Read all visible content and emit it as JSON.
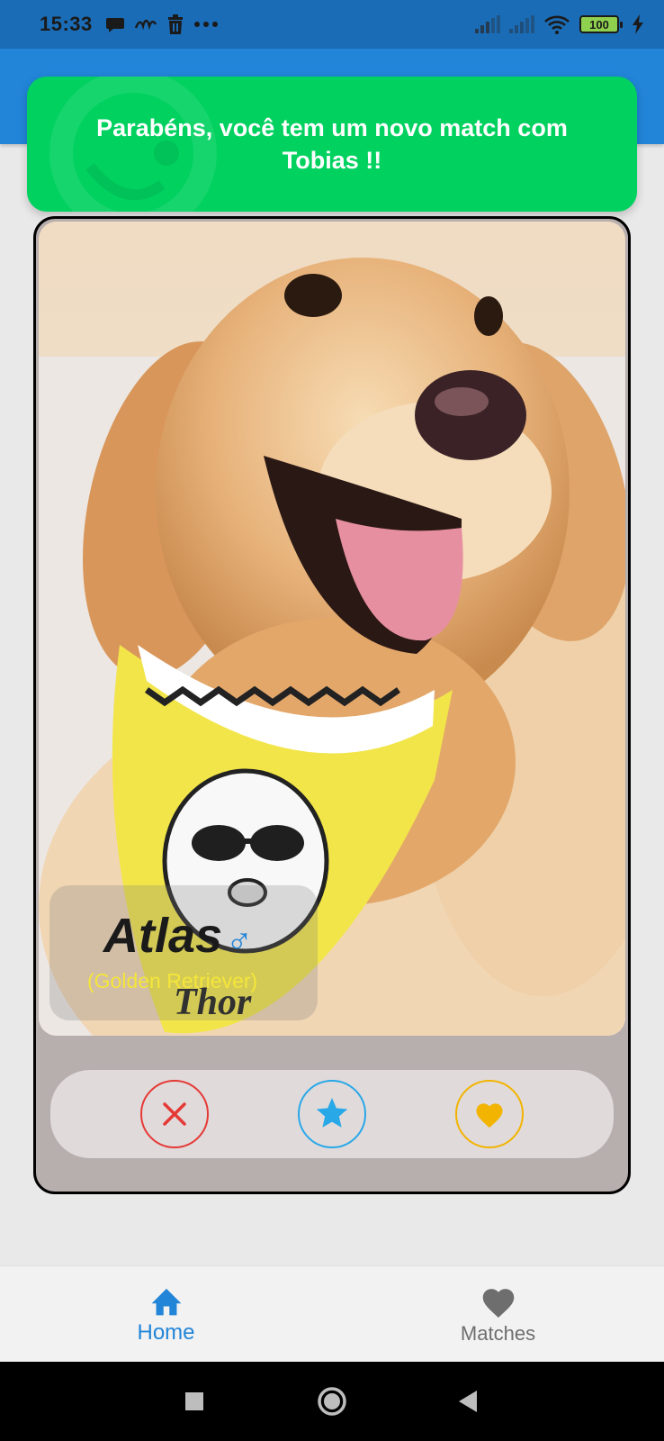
{
  "status_bar": {
    "time": "15:33",
    "battery": "100",
    "icons": [
      "chat-bubble-icon",
      "app-logo-icon",
      "trash-icon",
      "more-dots-icon",
      "signal-icon",
      "signal-icon",
      "wifi-icon",
      "battery-icon",
      "charging-icon"
    ]
  },
  "toast": {
    "message": "Parabéns, você tem um novo match com Tobias !!",
    "color": "#00d15f"
  },
  "card": {
    "pet_name": "Atlas",
    "sex_symbol": "♂",
    "breed": "(Golden Retriever)",
    "photo_text": "Thor",
    "actions": {
      "nope_icon": "close-icon",
      "super_icon": "star-icon",
      "like_icon": "heart-icon"
    }
  },
  "bottom_nav": {
    "items": [
      {
        "label": "Home",
        "icon": "home-icon",
        "active": true
      },
      {
        "label": "Matches",
        "icon": "heart-icon",
        "active": false
      }
    ]
  },
  "colors": {
    "status_bar": "#1b6cb6",
    "app_bar": "#2285d8",
    "accent": "#2285d8",
    "nope": "#e53935",
    "super": "#29a8e8",
    "like": "#f2b400"
  }
}
